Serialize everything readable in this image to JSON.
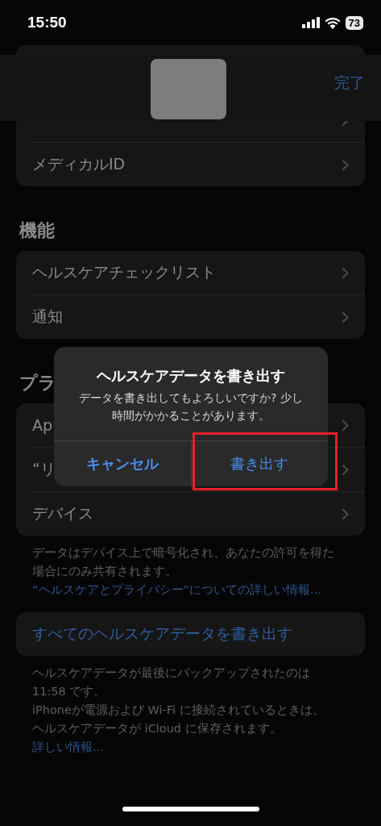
{
  "status_bar": {
    "time": "15:50",
    "battery": "73"
  },
  "nav": {
    "done": "完了"
  },
  "sections": [
    {
      "rows": [
        {
          "kind": "obscured"
        },
        {
          "kind": "link",
          "label": "メディカルID"
        }
      ]
    },
    {
      "header": "機能",
      "rows": [
        {
          "kind": "link",
          "label": "ヘルスケアチェックリスト"
        },
        {
          "kind": "link",
          "label": "通知"
        }
      ]
    },
    {
      "header": "プラ",
      "rows": [
        {
          "kind": "link",
          "label": "Ap"
        },
        {
          "kind": "link",
          "label": "“リ"
        },
        {
          "kind": "link",
          "label": "デバイス"
        }
      ],
      "footer": [
        {
          "text": "データはデバイス上で暗号化され、あなたの許可を得た場合にのみ共有されます。"
        },
        {
          "link": "“ヘルスケアとプライバシー”についての詳しい情報..."
        }
      ]
    },
    {
      "rows": [
        {
          "kind": "action",
          "label": "すべてのヘルスケアデータを書き出す"
        }
      ],
      "footer": [
        {
          "text": "ヘルスケアデータが最後にバックアップされたのは 11:58 です。"
        },
        {
          "text": "iPhoneが電源および Wi-Fi に接続されているときは、ヘルスケアデータが iCloud に保存されます。",
          "link": "詳しい情報..."
        }
      ]
    }
  ],
  "alert": {
    "title": "ヘルスケアデータを書き出す",
    "message": "データを書き出してもよろしいですか? 少し時間がかかることがあります。",
    "buttons": [
      {
        "label": "キャンセル",
        "kind": "cancel",
        "highlighted": false
      },
      {
        "label": "書き出す",
        "kind": "default",
        "highlighted": true
      }
    ]
  }
}
